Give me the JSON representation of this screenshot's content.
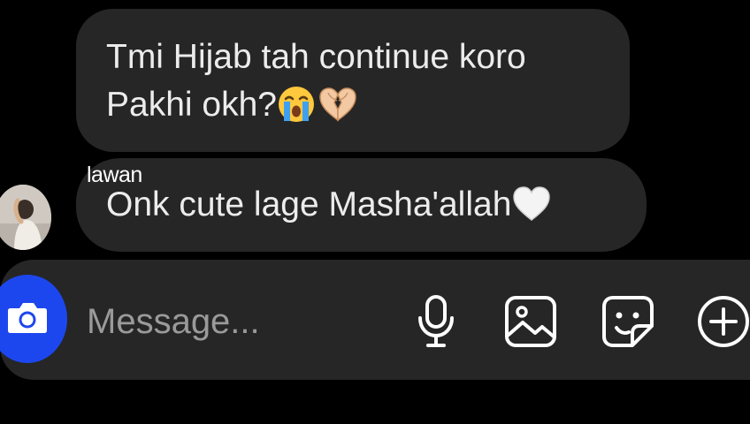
{
  "conversation": {
    "messages": [
      {
        "lines": [
          "Tmi Hijab tah continue koro",
          "Pakhi okh?"
        ],
        "emojis": [
          "loudly-crying-face",
          "heart-hands"
        ]
      },
      {
        "text": "Onk cute lage Masha'allah",
        "emojis": [
          "white-heart"
        ]
      }
    ],
    "caption": "lawan"
  },
  "composer": {
    "placeholder": "Message...",
    "icons": [
      "camera-icon",
      "microphone-icon",
      "image-gallery-icon",
      "sticker-icon",
      "plus-icon"
    ]
  },
  "colors": {
    "background": "#000000",
    "bubble": "#262626",
    "text": "#ececec",
    "placeholder": "#9a9a9a",
    "camera_button": "#1d47ee"
  }
}
